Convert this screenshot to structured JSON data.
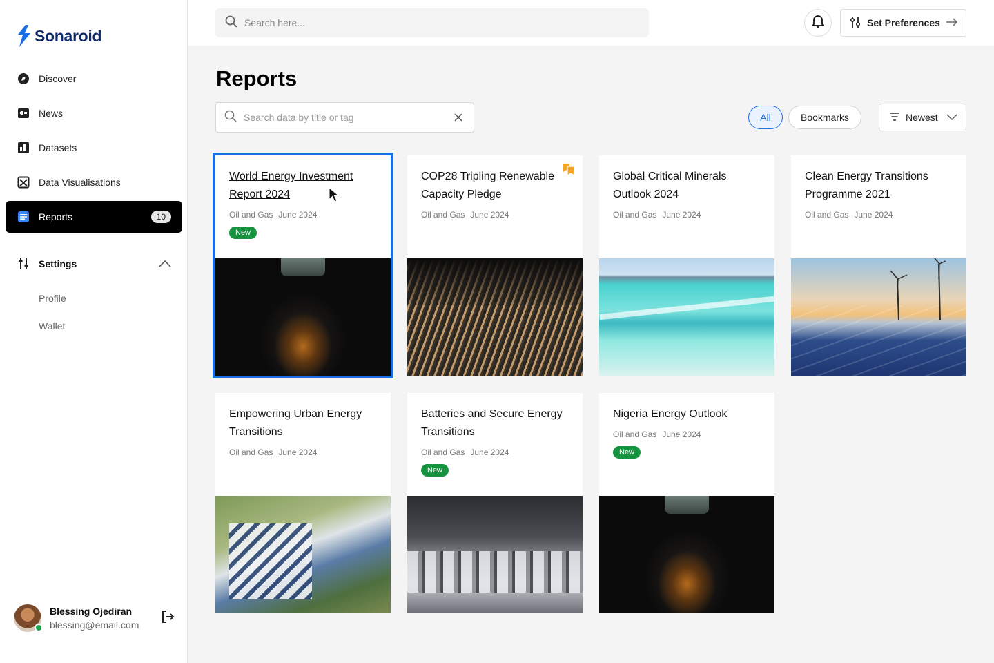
{
  "app": {
    "name": "Sonaroid",
    "accent": "#1a6ee6"
  },
  "sidebar": {
    "items": [
      {
        "label": "Discover",
        "icon": "compass-icon"
      },
      {
        "label": "News",
        "icon": "megaphone-icon"
      },
      {
        "label": "Datasets",
        "icon": "bar-chart-icon"
      },
      {
        "label": "Data Visualisations",
        "icon": "chart-box-icon"
      },
      {
        "label": "Reports",
        "icon": "document-icon",
        "badge": "10",
        "active": true
      }
    ],
    "settings": {
      "label": "Settings",
      "sub": [
        "Profile",
        "Wallet"
      ]
    },
    "user": {
      "name": "Blessing Ojediran",
      "email": "blessing@email.com"
    }
  },
  "topbar": {
    "search_placeholder": "Search here...",
    "preferences_label": "Set Preferences"
  },
  "main": {
    "title": "Reports",
    "search_placeholder": "Search data by title or tag",
    "filters": [
      "All",
      "Bookmarks"
    ],
    "sort_label": "Newest",
    "cards": [
      {
        "title": "World Energy Investment Report 2024",
        "category": "Oil and Gas",
        "date": "June 2024",
        "badge": "New",
        "image": "light-bulb",
        "selected": true
      },
      {
        "title": "COP28 Tripling Renewable Capacity Pledge",
        "category": "Oil and Gas",
        "date": "June 2024",
        "image": "solar-field",
        "bookmarked": true
      },
      {
        "title": "Global Critical Minerals Outlook 2024",
        "category": "Oil and Gas",
        "date": "June 2024",
        "image": "lithium-ponds"
      },
      {
        "title": "Clean Energy Transitions Programme 2021",
        "category": "Oil and Gas",
        "date": "June 2024",
        "image": "wind-solar"
      },
      {
        "title": "Empowering Urban Energy Transitions",
        "category": "Oil and Gas",
        "date": "June 2024",
        "image": "urban-rooftops"
      },
      {
        "title": "Batteries and Secure Energy Transitions",
        "category": "Oil and Gas",
        "date": "June 2024",
        "badge": "New",
        "image": "battery-line"
      },
      {
        "title": "Nigeria Energy Outlook",
        "category": "Oil and Gas",
        "date": "June 2024",
        "badge": "New",
        "image": "light-bulb"
      }
    ]
  }
}
